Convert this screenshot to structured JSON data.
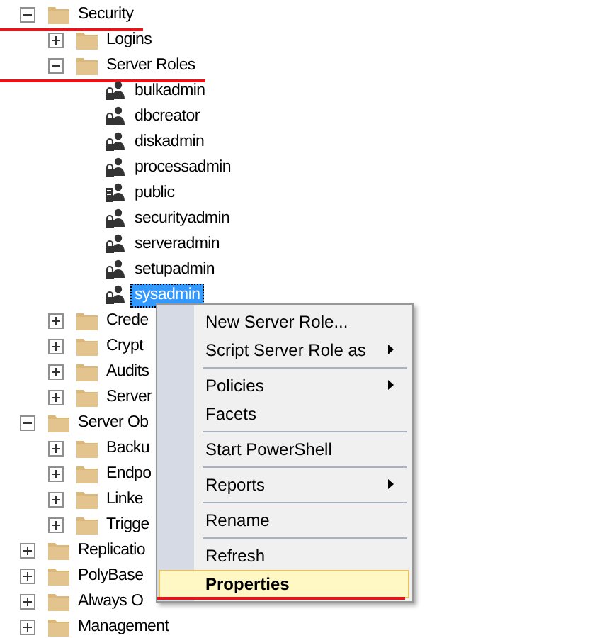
{
  "tree": [
    {
      "label": "Security",
      "kind": "folder",
      "expanded": true,
      "selected": false,
      "marked": true,
      "children": [
        {
          "label": "Logins",
          "kind": "folder",
          "expanded": false,
          "selected": false
        },
        {
          "label": "Server Roles",
          "kind": "folder",
          "expanded": true,
          "selected": false,
          "marked": true,
          "children": [
            {
              "label": "bulkadmin",
              "kind": "role",
              "selected": false
            },
            {
              "label": "dbcreator",
              "kind": "role",
              "selected": false
            },
            {
              "label": "diskadmin",
              "kind": "role",
              "selected": false
            },
            {
              "label": "processadmin",
              "kind": "role",
              "selected": false
            },
            {
              "label": "public",
              "kind": "public-role",
              "selected": false
            },
            {
              "label": "securityadmin",
              "kind": "role",
              "selected": false
            },
            {
              "label": "serveradmin",
              "kind": "role",
              "selected": false
            },
            {
              "label": "setupadmin",
              "kind": "role",
              "selected": false
            },
            {
              "label": "sysadmin",
              "kind": "role",
              "selected": true
            }
          ]
        },
        {
          "label": "Crede",
          "kind": "folder",
          "expanded": false,
          "selected": false
        },
        {
          "label": "Crypt",
          "kind": "folder",
          "expanded": false,
          "selected": false
        },
        {
          "label": "Audits",
          "kind": "folder",
          "expanded": false,
          "selected": false
        },
        {
          "label": "Server",
          "kind": "folder",
          "expanded": false,
          "selected": false
        }
      ]
    },
    {
      "label": "Server Ob",
      "kind": "folder",
      "expanded": true,
      "selected": false,
      "children": [
        {
          "label": "Backu",
          "kind": "folder",
          "expanded": false,
          "selected": false
        },
        {
          "label": "Endpo",
          "kind": "folder",
          "expanded": false,
          "selected": false
        },
        {
          "label": "Linke",
          "kind": "folder",
          "expanded": false,
          "selected": false
        },
        {
          "label": "Trigge",
          "kind": "folder",
          "expanded": false,
          "selected": false
        }
      ]
    },
    {
      "label": "Replicatio",
      "kind": "folder",
      "expanded": false,
      "selected": false
    },
    {
      "label": "PolyBase",
      "kind": "folder",
      "expanded": false,
      "selected": false
    },
    {
      "label": "Always O",
      "kind": "folder",
      "expanded": false,
      "selected": false
    },
    {
      "label": "Management",
      "kind": "folder",
      "expanded": false,
      "selected": false
    }
  ],
  "context_menu": [
    {
      "kind": "item",
      "label": "New Server Role...",
      "submenu": false,
      "selected": false
    },
    {
      "kind": "item",
      "label": "Script Server Role as",
      "submenu": true,
      "selected": false
    },
    {
      "kind": "separator"
    },
    {
      "kind": "item",
      "label": "Policies",
      "submenu": true,
      "selected": false
    },
    {
      "kind": "item",
      "label": "Facets",
      "submenu": false,
      "selected": false
    },
    {
      "kind": "separator"
    },
    {
      "kind": "item",
      "label": "Start PowerShell",
      "submenu": false,
      "selected": false
    },
    {
      "kind": "separator"
    },
    {
      "kind": "item",
      "label": "Reports",
      "submenu": true,
      "selected": false
    },
    {
      "kind": "separator"
    },
    {
      "kind": "item",
      "label": "Rename",
      "submenu": false,
      "selected": false
    },
    {
      "kind": "separator"
    },
    {
      "kind": "item",
      "label": "Refresh",
      "submenu": false,
      "selected": false
    },
    {
      "kind": "item",
      "label": "Properties",
      "submenu": false,
      "selected": true,
      "default": true,
      "marked": true
    }
  ]
}
